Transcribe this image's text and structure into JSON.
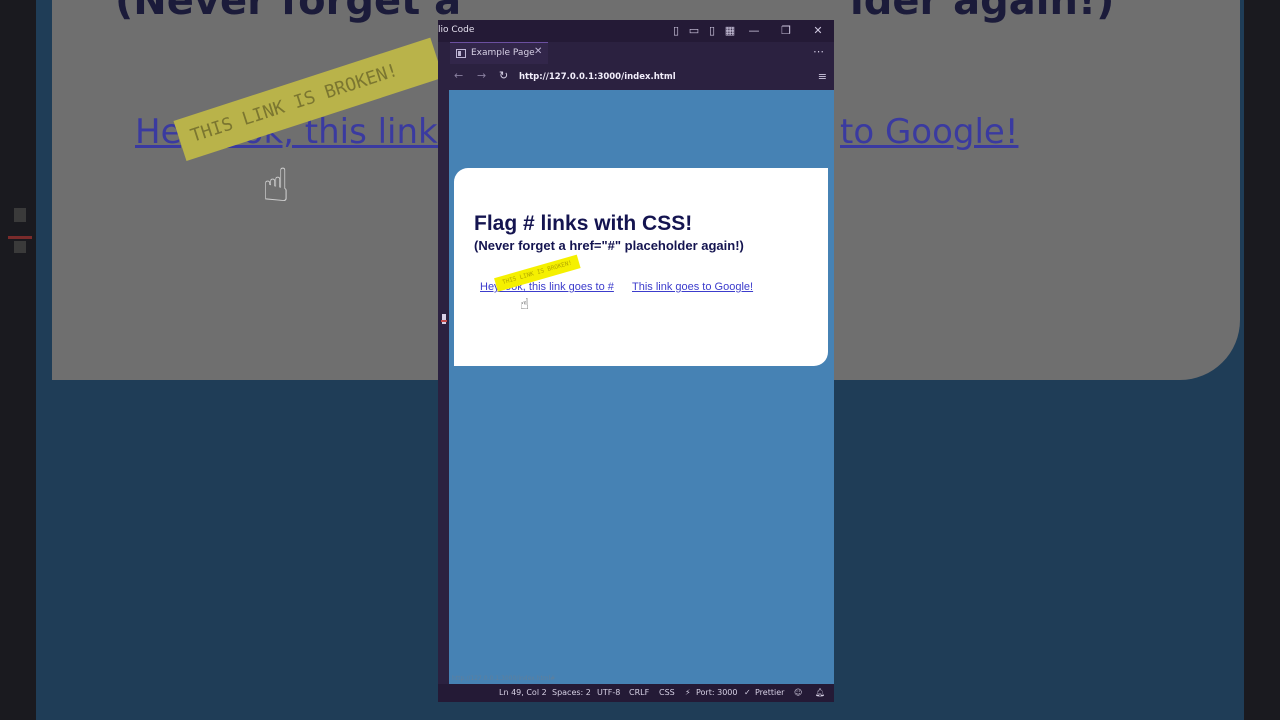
{
  "window": {
    "app_title": "lio Code"
  },
  "tab": {
    "label": "Example Page",
    "close": "✕"
  },
  "nav": {
    "url": "http://127.0.0.1:3000/index.html"
  },
  "page": {
    "title": "Flag # links with CSS!",
    "subtitle": "(Never forget a href=\"#\" placeholder again!)",
    "link_hash": "Hey look, this link goes to #",
    "link_google": "This link goes to Google!",
    "sticker": "THIS LINK IS BROKEN!"
  },
  "background": {
    "title_left": "(Never forget a",
    "title_right": "lder again!)",
    "link_left": "Hey look, this link g",
    "link_right": "to Google!",
    "sticker": "THIS LINK IS BROKEN!"
  },
  "statusbar": {
    "position": "Ln 49, Col 2",
    "spaces": "Spaces: 2",
    "encoding": "UTF-8",
    "eol": "CRLF",
    "language": "CSS",
    "port": "Port: 3000",
    "prettier": "Prettier",
    "hover_url": "http://127.0.0.1:3000/index.html#"
  },
  "colors": {
    "viewport_bg": "#4682b4",
    "card_bg": "#ffffff",
    "heading": "#141450",
    "link": "#3c3ccc",
    "sticker": "#f5f000"
  }
}
